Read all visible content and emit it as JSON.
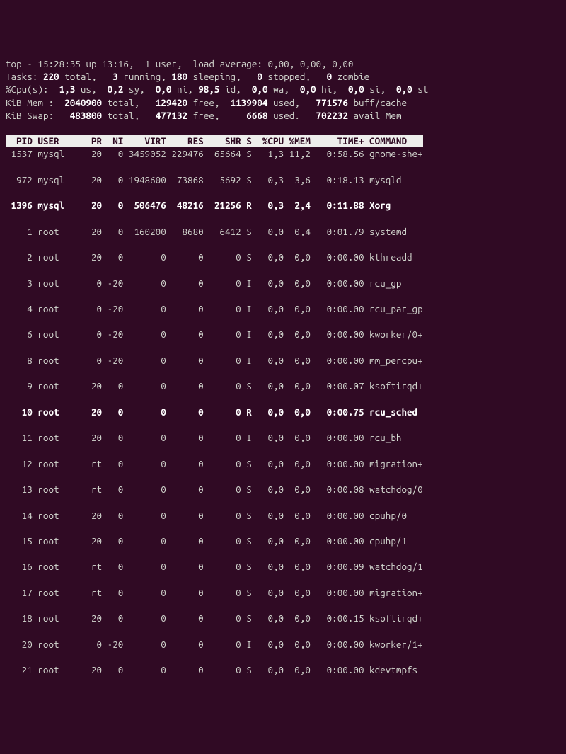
{
  "summary": {
    "line1_prefix": "top - ",
    "time": "15:28:35",
    "up_label": " up ",
    "uptime": "13:16",
    "users": ",  1 user,  ",
    "load_label": "load average: ",
    "load_avg": "0,00, 0,00, 0,00",
    "tasks_prefix": "Tasks: ",
    "tasks_total": "220",
    "tasks_total_lbl": " total,   ",
    "tasks_running": "3",
    "tasks_running_lbl": " running, ",
    "tasks_sleeping": "180",
    "tasks_sleeping_lbl": " sleeping,   ",
    "tasks_stopped": "0",
    "tasks_stopped_lbl": " stopped,   ",
    "tasks_zombie": "0",
    "tasks_zombie_lbl": " zombie",
    "cpu_prefix": "%Cpu(s):  ",
    "cpu_us": "1,3",
    "cpu_us_lbl": " us,  ",
    "cpu_sy": "0,2",
    "cpu_sy_lbl": " sy,  ",
    "cpu_ni": "0,0",
    "cpu_ni_lbl": " ni, ",
    "cpu_id": "98,5",
    "cpu_id_lbl": " id,  ",
    "cpu_wa": "0,0",
    "cpu_wa_lbl": " wa,  ",
    "cpu_hi": "0,0",
    "cpu_hi_lbl": " hi,  ",
    "cpu_si": "0,0",
    "cpu_si_lbl": " si,  ",
    "cpu_st": "0,0",
    "cpu_st_lbl": " st",
    "mem_prefix": "KiB Mem :  ",
    "mem_total": "2040900",
    "mem_total_lbl": " total,   ",
    "mem_free": "129420",
    "mem_free_lbl": " free,  ",
    "mem_used": "1139904",
    "mem_used_lbl": " used,   ",
    "mem_buff": "771576",
    "mem_buff_lbl": " buff/cache",
    "swap_prefix": "KiB Swap:   ",
    "swap_total": "483800",
    "swap_total_lbl": " total,   ",
    "swap_free": "477132",
    "swap_free_lbl": " free,     ",
    "swap_used": "6668",
    "swap_used_lbl": " used.   ",
    "swap_avail": "702232",
    "swap_avail_lbl": " avail Mem"
  },
  "header": "  PID USER      PR  NI    VIRT    RES    SHR S  %CPU %MEM     TIME+ COMMAND   ",
  "processes": [
    {
      "bold": false,
      "pid": "1537",
      "user": "mysql",
      "pr": "20",
      "ni": "0",
      "virt": "3459052",
      "res": "229476",
      "shr": "65664",
      "s": "S",
      "cpu": "1,3",
      "mem": "11,2",
      "time": "0:58.56",
      "cmd": "gnome-she+"
    },
    {
      "bold": false,
      "pid": "972",
      "user": "mysql",
      "pr": "20",
      "ni": "0",
      "virt": "1948600",
      "res": "73868",
      "shr": "5692",
      "s": "S",
      "cpu": "0,3",
      "mem": "3,6",
      "time": "0:18.13",
      "cmd": "mysqld"
    },
    {
      "bold": true,
      "pid": "1396",
      "user": "mysql",
      "pr": "20",
      "ni": "0",
      "virt": "506476",
      "res": "48216",
      "shr": "21256",
      "s": "R",
      "cpu": "0,3",
      "mem": "2,4",
      "time": "0:11.88",
      "cmd": "Xorg"
    },
    {
      "bold": false,
      "pid": "1",
      "user": "root",
      "pr": "20",
      "ni": "0",
      "virt": "160200",
      "res": "8680",
      "shr": "6412",
      "s": "S",
      "cpu": "0,0",
      "mem": "0,4",
      "time": "0:01.79",
      "cmd": "systemd"
    },
    {
      "bold": false,
      "pid": "2",
      "user": "root",
      "pr": "20",
      "ni": "0",
      "virt": "0",
      "res": "0",
      "shr": "0",
      "s": "S",
      "cpu": "0,0",
      "mem": "0,0",
      "time": "0:00.00",
      "cmd": "kthreadd"
    },
    {
      "bold": false,
      "pid": "3",
      "user": "root",
      "pr": "0",
      "ni": "-20",
      "virt": "0",
      "res": "0",
      "shr": "0",
      "s": "I",
      "cpu": "0,0",
      "mem": "0,0",
      "time": "0:00.00",
      "cmd": "rcu_gp"
    },
    {
      "bold": false,
      "pid": "4",
      "user": "root",
      "pr": "0",
      "ni": "-20",
      "virt": "0",
      "res": "0",
      "shr": "0",
      "s": "I",
      "cpu": "0,0",
      "mem": "0,0",
      "time": "0:00.00",
      "cmd": "rcu_par_gp"
    },
    {
      "bold": false,
      "pid": "6",
      "user": "root",
      "pr": "0",
      "ni": "-20",
      "virt": "0",
      "res": "0",
      "shr": "0",
      "s": "I",
      "cpu": "0,0",
      "mem": "0,0",
      "time": "0:00.00",
      "cmd": "kworker/0+"
    },
    {
      "bold": false,
      "pid": "8",
      "user": "root",
      "pr": "0",
      "ni": "-20",
      "virt": "0",
      "res": "0",
      "shr": "0",
      "s": "I",
      "cpu": "0,0",
      "mem": "0,0",
      "time": "0:00.00",
      "cmd": "mm_percpu+"
    },
    {
      "bold": false,
      "pid": "9",
      "user": "root",
      "pr": "20",
      "ni": "0",
      "virt": "0",
      "res": "0",
      "shr": "0",
      "s": "S",
      "cpu": "0,0",
      "mem": "0,0",
      "time": "0:00.07",
      "cmd": "ksoftirqd+"
    },
    {
      "bold": true,
      "pid": "10",
      "user": "root",
      "pr": "20",
      "ni": "0",
      "virt": "0",
      "res": "0",
      "shr": "0",
      "s": "R",
      "cpu": "0,0",
      "mem": "0,0",
      "time": "0:00.75",
      "cmd": "rcu_sched"
    },
    {
      "bold": false,
      "pid": "11",
      "user": "root",
      "pr": "20",
      "ni": "0",
      "virt": "0",
      "res": "0",
      "shr": "0",
      "s": "I",
      "cpu": "0,0",
      "mem": "0,0",
      "time": "0:00.00",
      "cmd": "rcu_bh"
    },
    {
      "bold": false,
      "pid": "12",
      "user": "root",
      "pr": "rt",
      "ni": "0",
      "virt": "0",
      "res": "0",
      "shr": "0",
      "s": "S",
      "cpu": "0,0",
      "mem": "0,0",
      "time": "0:00.00",
      "cmd": "migration+"
    },
    {
      "bold": false,
      "pid": "13",
      "user": "root",
      "pr": "rt",
      "ni": "0",
      "virt": "0",
      "res": "0",
      "shr": "0",
      "s": "S",
      "cpu": "0,0",
      "mem": "0,0",
      "time": "0:00.08",
      "cmd": "watchdog/0"
    },
    {
      "bold": false,
      "pid": "14",
      "user": "root",
      "pr": "20",
      "ni": "0",
      "virt": "0",
      "res": "0",
      "shr": "0",
      "s": "S",
      "cpu": "0,0",
      "mem": "0,0",
      "time": "0:00.00",
      "cmd": "cpuhp/0"
    },
    {
      "bold": false,
      "pid": "15",
      "user": "root",
      "pr": "20",
      "ni": "0",
      "virt": "0",
      "res": "0",
      "shr": "0",
      "s": "S",
      "cpu": "0,0",
      "mem": "0,0",
      "time": "0:00.00",
      "cmd": "cpuhp/1"
    },
    {
      "bold": false,
      "pid": "16",
      "user": "root",
      "pr": "rt",
      "ni": "0",
      "virt": "0",
      "res": "0",
      "shr": "0",
      "s": "S",
      "cpu": "0,0",
      "mem": "0,0",
      "time": "0:00.09",
      "cmd": "watchdog/1"
    },
    {
      "bold": false,
      "pid": "17",
      "user": "root",
      "pr": "rt",
      "ni": "0",
      "virt": "0",
      "res": "0",
      "shr": "0",
      "s": "S",
      "cpu": "0,0",
      "mem": "0,0",
      "time": "0:00.00",
      "cmd": "migration+"
    },
    {
      "bold": false,
      "pid": "18",
      "user": "root",
      "pr": "20",
      "ni": "0",
      "virt": "0",
      "res": "0",
      "shr": "0",
      "s": "S",
      "cpu": "0,0",
      "mem": "0,0",
      "time": "0:00.15",
      "cmd": "ksoftirqd+"
    },
    {
      "bold": false,
      "pid": "20",
      "user": "root",
      "pr": "0",
      "ni": "-20",
      "virt": "0",
      "res": "0",
      "shr": "0",
      "s": "I",
      "cpu": "0,0",
      "mem": "0,0",
      "time": "0:00.00",
      "cmd": "kworker/1+"
    },
    {
      "bold": false,
      "pid": "21",
      "user": "root",
      "pr": "20",
      "ni": "0",
      "virt": "0",
      "res": "0",
      "shr": "0",
      "s": "S",
      "cpu": "0,0",
      "mem": "0,0",
      "time": "0:00.00",
      "cmd": "kdevtmpfs"
    }
  ]
}
